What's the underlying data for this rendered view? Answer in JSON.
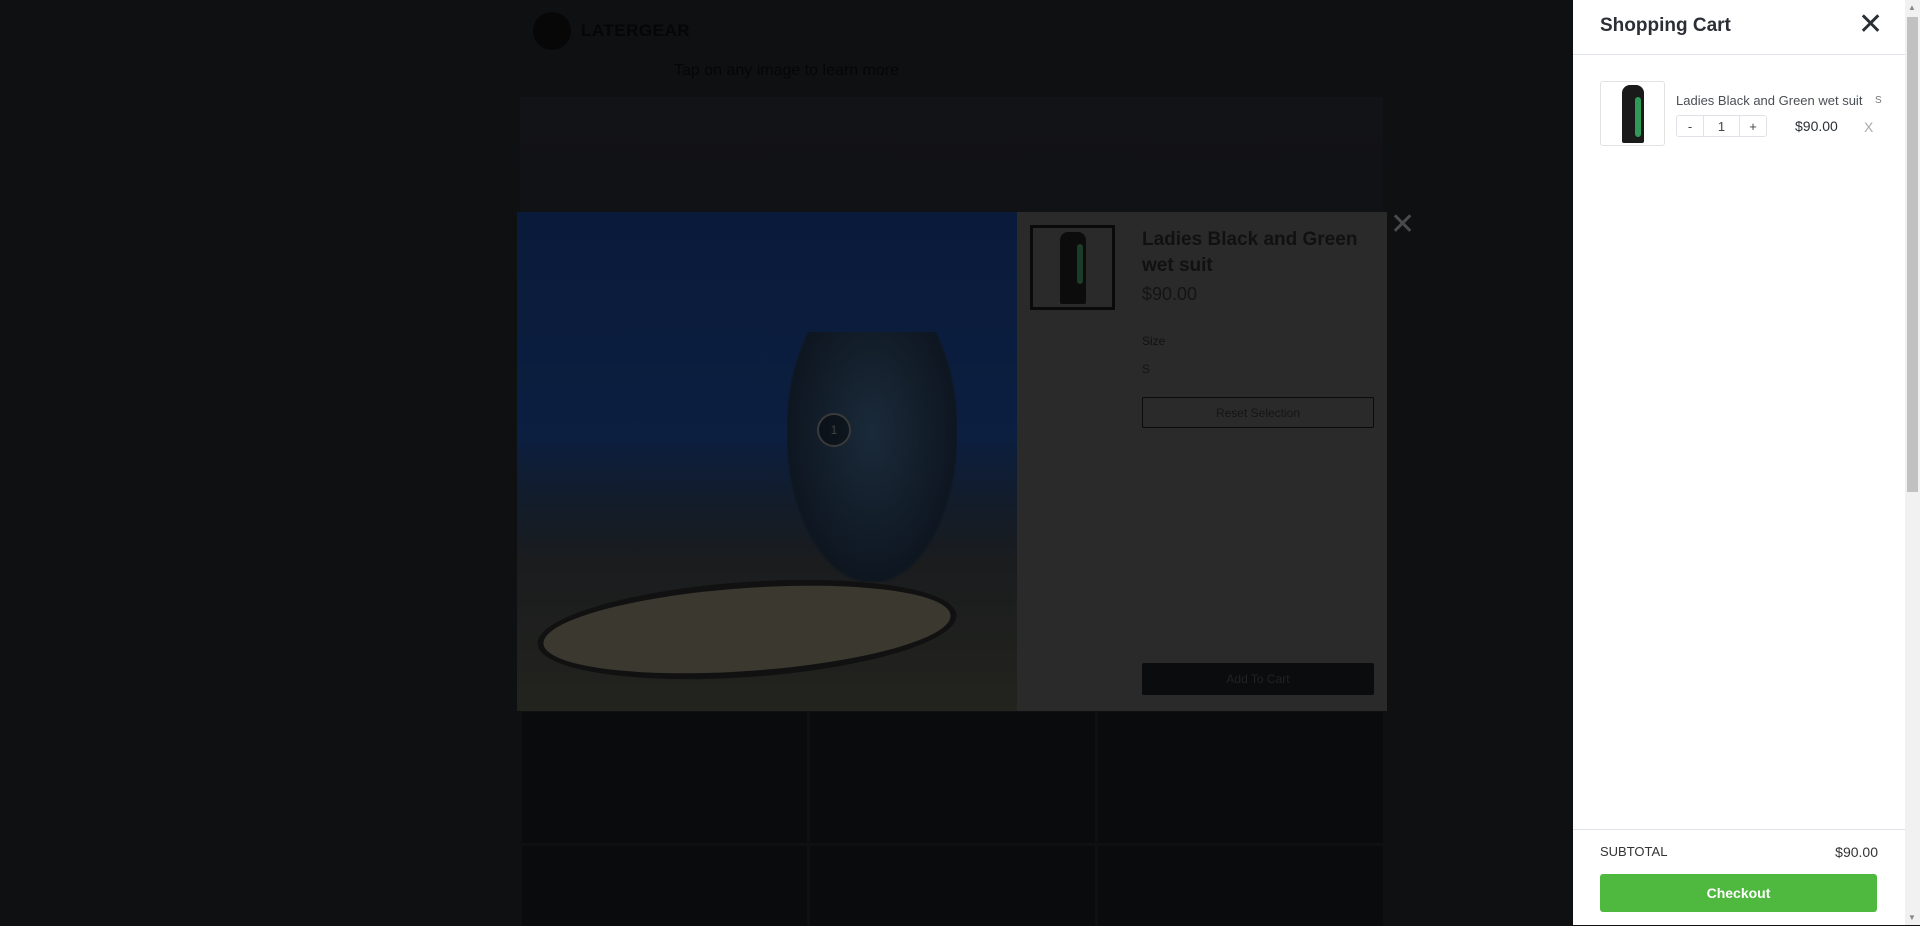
{
  "page": {
    "brand": "LATERGEAR",
    "tagline": "Tap on any image to learn more"
  },
  "modal": {
    "hotspot": "1",
    "title": "Ladies Black and Green wet suit",
    "price": "$90.00",
    "size_label": "Size",
    "size_value": "S",
    "reset_label": "Reset Selection",
    "add_label": "Add To Cart",
    "close": "✕"
  },
  "cart": {
    "title": "Shopping Cart",
    "close": "✕",
    "items": [
      {
        "name": "Ladies Black and Green wet suit",
        "variant": "S",
        "minus": "-",
        "qty": "1",
        "plus": "+",
        "price": "$90.00",
        "remove": "X"
      }
    ],
    "subtotal_label": "SUBTOTAL",
    "subtotal": "$90.00",
    "checkout_label": "Checkout"
  },
  "colors": {
    "checkout": "#4fb83e"
  }
}
